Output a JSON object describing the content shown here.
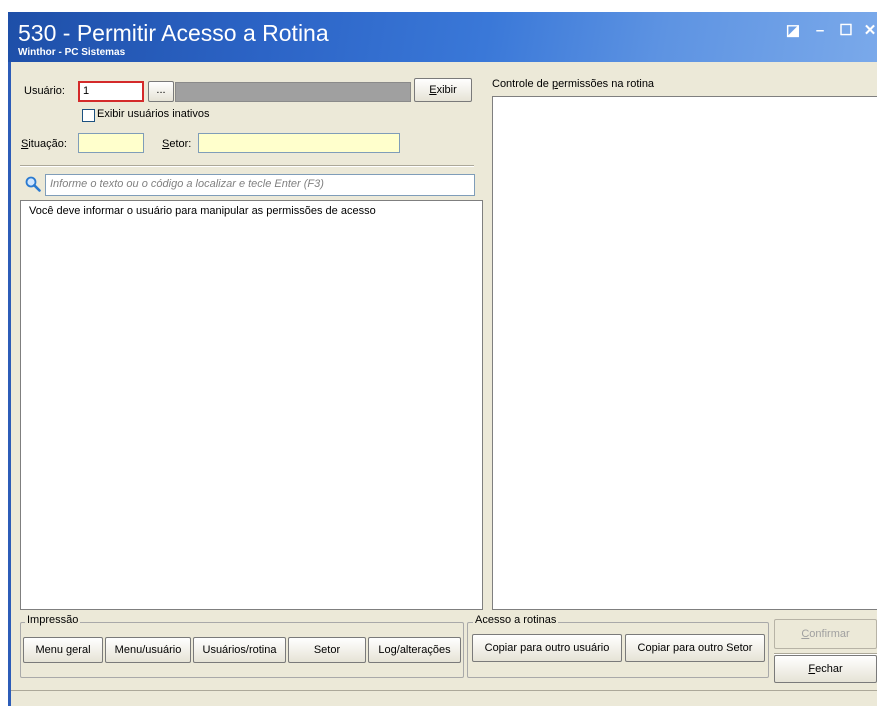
{
  "window": {
    "title": "530 - Permitir Acesso a Rotina",
    "subtitle": "Winthor - PC Sistemas",
    "controls": {
      "restore": "◪",
      "minimize": "–",
      "maximize": "☐",
      "close": "✕"
    }
  },
  "user_section": {
    "usuario_label": "Usuário:",
    "usuario_value": "1",
    "browse_label": "...",
    "exibir_label": "Exibir",
    "inactive_checkbox_label": "Exibir usuários inativos",
    "situacao_label": "Situação:",
    "setor_label": "Setor:"
  },
  "search": {
    "placeholder": "Informe o texto ou o código a localizar e tecle Enter (F3)"
  },
  "left_list": {
    "message": "Você deve informar o usuário para manipular as permissões de acesso"
  },
  "right_panel": {
    "title": "Controle de permissões na rotina"
  },
  "impressao": {
    "label": "Impressão",
    "buttons": [
      "Menu geral",
      "Menu/usuário",
      "Usuários/rotina",
      "Setor",
      "Log/alterações"
    ]
  },
  "acesso": {
    "label": "Acesso a rotinas",
    "buttons": [
      "Copiar para outro usuário",
      "Copiar para outro Setor"
    ]
  },
  "actions": {
    "confirmar": "Confirmar",
    "fechar": "Fechar"
  },
  "colors": {
    "titlebar": "#2c64c6",
    "face": "#ece9d8",
    "focus_border": "#d42a2a",
    "readonly_field": "#ffffcc"
  }
}
